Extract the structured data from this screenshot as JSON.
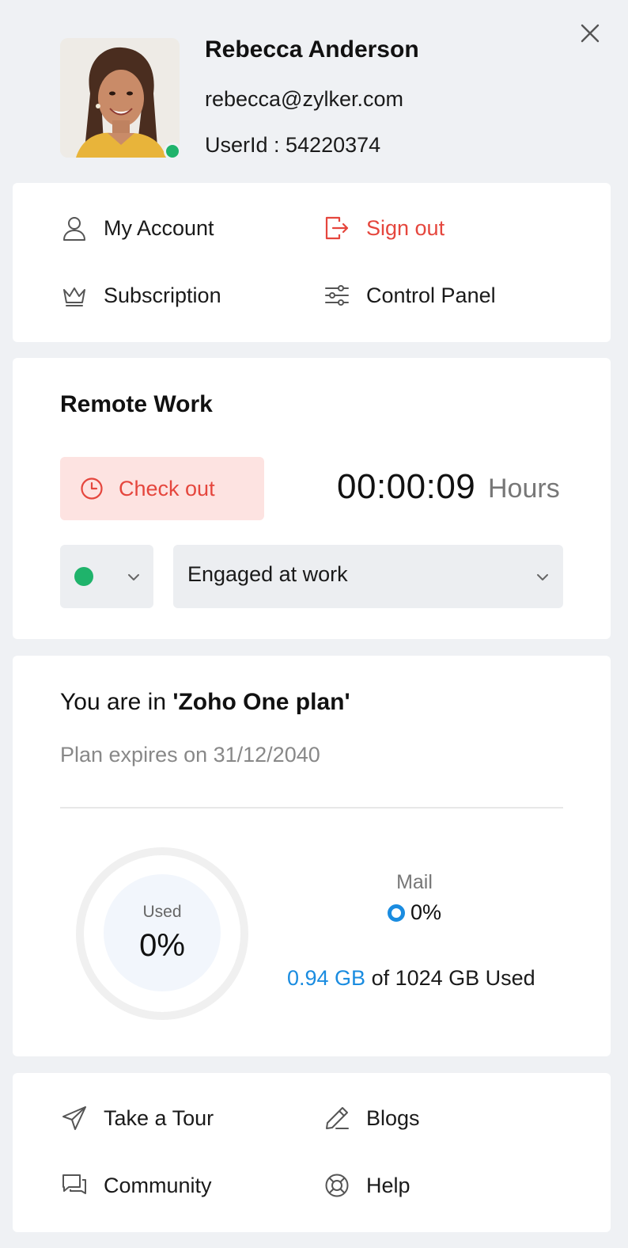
{
  "profile": {
    "name": "Rebecca Anderson",
    "email": "rebecca@zylker.com",
    "user_id": "UserId : 54220374",
    "presence": "online"
  },
  "quick_links": [
    {
      "label": "My Account",
      "icon": "user-icon"
    },
    {
      "label": "Sign out",
      "icon": "sign-out-icon"
    },
    {
      "label": "Subscription",
      "icon": "crown-icon"
    },
    {
      "label": "Control Panel",
      "icon": "sliders-icon"
    }
  ],
  "remote_work": {
    "title": "Remote Work",
    "checkout_label": "Check out",
    "timer": "00:00:09",
    "timer_unit": "Hours",
    "status": "online",
    "activity": "Engaged at work"
  },
  "plan": {
    "prefix": "You are in ",
    "name": "'Zoho One plan'",
    "expiry": "Plan expires on 31/12/2040",
    "usage_label": "Used",
    "usage_percent": "0%",
    "usage_fraction": 0.0,
    "mail_label": "Mail",
    "mail_percent": "0%",
    "storage_used": "0.94 GB",
    "storage_rest": " of 1024 GB Used"
  },
  "footer_links": [
    {
      "label": "Take a Tour",
      "icon": "paper-plane-icon"
    },
    {
      "label": "Blogs",
      "icon": "pen-icon"
    },
    {
      "label": "Community",
      "icon": "chat-icon"
    },
    {
      "label": "Help",
      "icon": "lifebuoy-icon"
    }
  ],
  "colors": {
    "background": "#eff1f4",
    "accent_red": "#e5463d",
    "online_green": "#1fb36b",
    "accent_blue": "#1a8ce0"
  }
}
